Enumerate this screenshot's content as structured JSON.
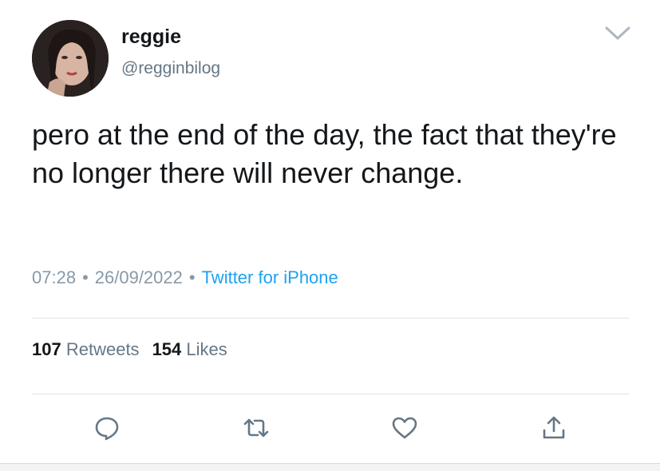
{
  "tweet": {
    "author_name": "reggie",
    "author_handle": "@regginbilog",
    "text": "pero at the end of the day, the fact that they're no longer there will never change.",
    "time": "07:28",
    "date": "26/09/2022",
    "separator": "•",
    "source": "Twitter for iPhone"
  },
  "stats": {
    "retweets_count": "107",
    "retweets_label": "Retweets",
    "likes_count": "154",
    "likes_label": "Likes"
  },
  "icons": {
    "more": "chevron-down-icon",
    "reply": "reply-icon",
    "retweet": "retweet-icon",
    "like": "heart-icon",
    "share": "share-icon"
  },
  "colors": {
    "accent": "#1da1f2",
    "action_icon": "#657786",
    "text": "#14171a",
    "secondary": "#8899a6"
  }
}
